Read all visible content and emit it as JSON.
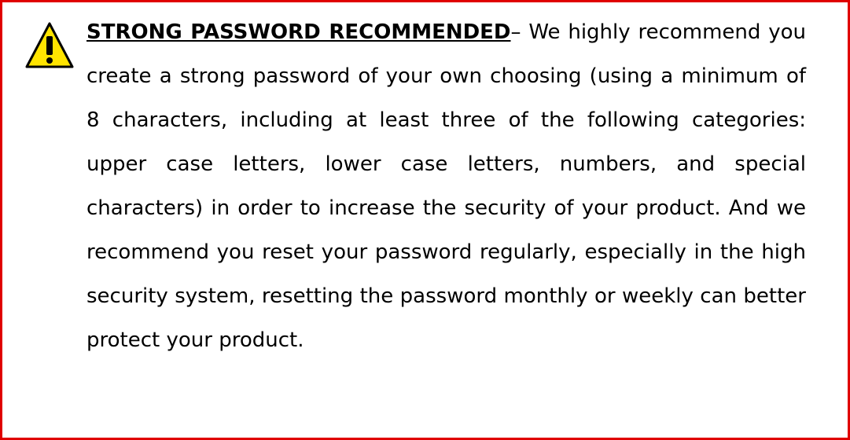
{
  "notice": {
    "icon": "warning-icon",
    "colors": {
      "border": "#e00000",
      "icon_fill": "#ffe400",
      "icon_stroke": "#000000"
    },
    "heading": "STRONG PASSWORD RECOMMENDED",
    "separator": "– ",
    "body": "We highly recommend you create a strong password of your own choosing (using a minimum of 8 characters, including at least three of the following categories: upper case letters, lower case letters, numbers, and special characters) in order to increase the security of your product. And we recommend you reset your password regularly, especially in the high security system, resetting the password monthly or weekly can better protect your product."
  }
}
